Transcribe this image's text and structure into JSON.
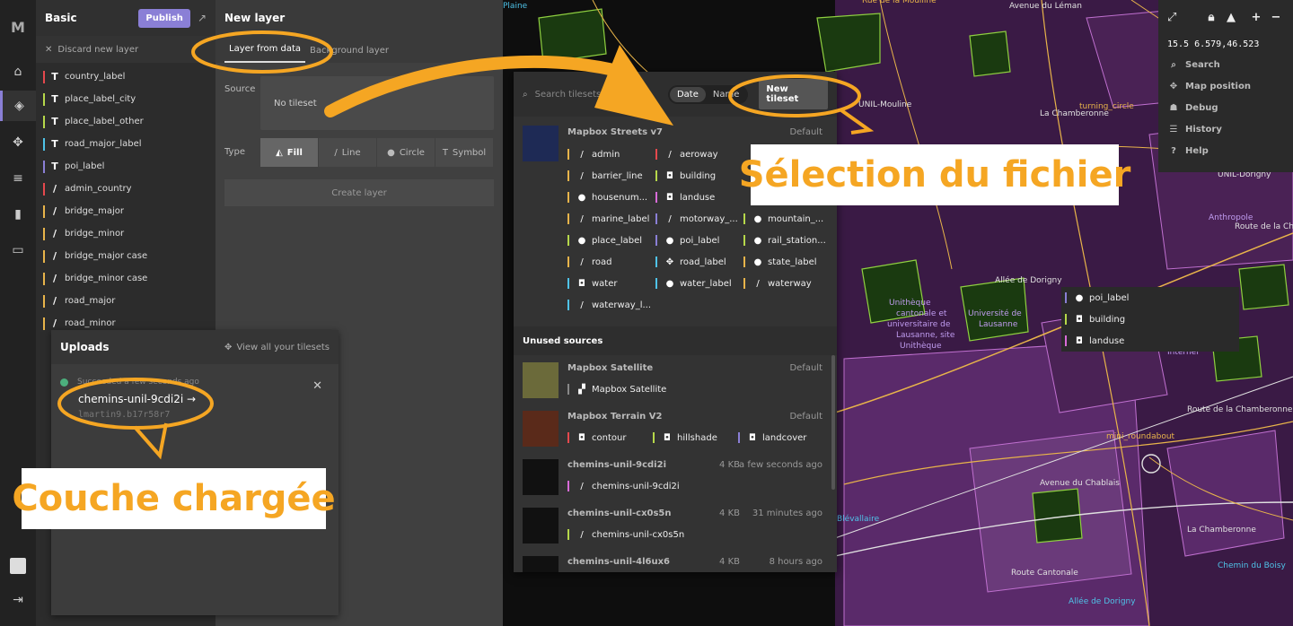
{
  "app": {
    "logo": "M"
  },
  "style": {
    "title": "Basic",
    "publish_label": "Publish",
    "discard_label": "Discard new layer",
    "layers": [
      {
        "icon": "T",
        "label": "country_label",
        "color": "#e5484d"
      },
      {
        "icon": "T",
        "label": "place_label_city",
        "color": "#b6d84a"
      },
      {
        "icon": "T",
        "label": "place_label_other",
        "color": "#b6d84a"
      },
      {
        "icon": "T",
        "label": "road_major_label",
        "color": "#4fc3e8"
      },
      {
        "icon": "T",
        "label": "poi_label",
        "color": "#8a7fd6"
      },
      {
        "icon": "/",
        "label": "admin_country",
        "color": "#e5484d"
      },
      {
        "icon": "/",
        "label": "bridge_major",
        "color": "#e8b44a"
      },
      {
        "icon": "/",
        "label": "bridge_minor",
        "color": "#e8b44a"
      },
      {
        "icon": "/",
        "label": "bridge_major case",
        "color": "#e8b44a"
      },
      {
        "icon": "/",
        "label": "bridge_minor case",
        "color": "#e8b44a"
      },
      {
        "icon": "/",
        "label": "road_major",
        "color": "#e8b44a"
      },
      {
        "icon": "/",
        "label": "road_minor",
        "color": "#e8b44a"
      }
    ]
  },
  "new_layer": {
    "title": "New layer",
    "tab_from_data": "Layer from data",
    "tab_background": "Background layer",
    "source_label": "Source",
    "no_tileset": "No tileset",
    "type_label": "Type",
    "types": [
      "Fill",
      "Line",
      "Circle",
      "Symbol"
    ],
    "create_label": "Create layer"
  },
  "uploads": {
    "title": "Uploads",
    "view_all": "View all your tilesets",
    "status": "Succeeded a few seconds ago",
    "name": "chemins-unil-9cdi2i",
    "arrow": "→",
    "id": "lmartin9.b17r58r7",
    "close": "✕"
  },
  "tileset_popup": {
    "search_placeholder": "Search tilesets",
    "sort_date": "Date",
    "sort_name": "Name",
    "new_tileset": "New tileset",
    "streets": {
      "name": "Mapbox Streets v7",
      "default": "Default",
      "layers": [
        {
          "i": "/",
          "label": "admin",
          "color": "#e8b44a"
        },
        {
          "i": "/",
          "label": "aeroway",
          "color": "#e5484d"
        },
        {
          "i": "",
          "label": "",
          "color": "#e5484d"
        },
        {
          "i": "/",
          "label": "barrier_line",
          "color": "#e8b44a"
        },
        {
          "i": "◘",
          "label": "building",
          "color": "#b6d84a"
        },
        {
          "i": "",
          "label": "",
          "color": "#e5484d"
        },
        {
          "i": "●",
          "label": "housenum...",
          "color": "#e8b44a"
        },
        {
          "i": "◘",
          "label": "landuse",
          "color": "#d86bd8"
        },
        {
          "i": "",
          "label": "",
          "color": "#e5484d"
        },
        {
          "i": "/",
          "label": "marine_label",
          "color": "#e8b44a"
        },
        {
          "i": "/",
          "label": "motorway_...",
          "color": "#8a7fd6"
        },
        {
          "i": "●",
          "label": "mountain_...",
          "color": "#b6d84a"
        },
        {
          "i": "●",
          "label": "place_label",
          "color": "#b6d84a"
        },
        {
          "i": "●",
          "label": "poi_label",
          "color": "#8a7fd6"
        },
        {
          "i": "●",
          "label": "rail_station...",
          "color": "#b6d84a"
        },
        {
          "i": "/",
          "label": "road",
          "color": "#e8b44a"
        },
        {
          "i": "✥",
          "label": "road_label",
          "color": "#4fc3e8"
        },
        {
          "i": "●",
          "label": "state_label",
          "color": "#e8b44a"
        },
        {
          "i": "◘",
          "label": "water",
          "color": "#4fc3e8"
        },
        {
          "i": "●",
          "label": "water_label",
          "color": "#4fc3e8"
        },
        {
          "i": "/",
          "label": "waterway",
          "color": "#e8b44a"
        },
        {
          "i": "/",
          "label": "waterway_l...",
          "color": "#4fc3e8"
        }
      ]
    },
    "unused_title": "Unused sources",
    "unused": [
      {
        "name": "Mapbox Satellite",
        "size": "",
        "meta": "Default",
        "layers": [
          {
            "i": "▞",
            "label": "Mapbox Satellite",
            "color": "#888"
          }
        ],
        "thumb": "#6b6a3a"
      },
      {
        "name": "Mapbox Terrain V2",
        "size": "",
        "meta": "Default",
        "layers": [
          {
            "i": "◘",
            "label": "contour",
            "color": "#e5484d"
          },
          {
            "i": "◘",
            "label": "hillshade",
            "color": "#b6d84a"
          },
          {
            "i": "◘",
            "label": "landcover",
            "color": "#8a7fd6"
          }
        ],
        "thumb": "#5a2a1a"
      },
      {
        "name": "chemins-unil-9cdi2i",
        "size": "4 KB",
        "meta": "a few seconds ago",
        "layers": [
          {
            "i": "/",
            "label": "chemins-unil-9cdi2i",
            "color": "#d86bd8"
          }
        ],
        "thumb": "#111"
      },
      {
        "name": "chemins-unil-cx0s5n",
        "size": "4 KB",
        "meta": "31 minutes ago",
        "layers": [
          {
            "i": "/",
            "label": "chemins-unil-cx0s5n",
            "color": "#b6d84a"
          }
        ],
        "thumb": "#111"
      },
      {
        "name": "chemins-unil-4l6ux6",
        "size": "4 KB",
        "meta": "8 hours ago",
        "layers": [],
        "thumb": "#111"
      }
    ]
  },
  "map_controls": {
    "coords": "15.5 6.579,46.523",
    "items": [
      {
        "icon": "⌕",
        "label": "Search"
      },
      {
        "icon": "✥",
        "label": "Map position"
      },
      {
        "icon": "☗",
        "label": "Debug"
      },
      {
        "icon": "☰",
        "label": "History"
      },
      {
        "icon": "?",
        "label": "Help"
      }
    ]
  },
  "map_hover": [
    {
      "i": "●",
      "label": "poi_label",
      "color": "#8a7fd6"
    },
    {
      "i": "◘",
      "label": "building",
      "color": "#b6d84a"
    },
    {
      "i": "◘",
      "label": "landuse",
      "color": "#d86bd8"
    }
  ],
  "map_labels": [
    "Plaine",
    "Rue de la Moulline",
    "Avenue du Léman",
    "UNIL-Mouline",
    "turning_circle",
    "La Chamberonne",
    "UNIL-Dorigny",
    "Anthropole",
    "Route de la Ch",
    "Allée de Dorigny",
    "Unithèque",
    "cantonale et",
    "universitaire de",
    "Lausanne, site",
    "Unithèque",
    "Université de",
    "Lausanne",
    "Internef",
    "Route de la Chamberonne",
    "mini_roundabout",
    "Avenue du Chablais",
    "Blévallaire",
    "La Chamberonne",
    "Chemin du Boisy",
    "Route Cantonale",
    "Allée de Dorigny"
  ],
  "annotations": {
    "selection": "Sélection du fichier",
    "loaded": "Couche chargée"
  },
  "colors": {
    "accent": "#f5a623",
    "purple": "#8a7fd6"
  }
}
